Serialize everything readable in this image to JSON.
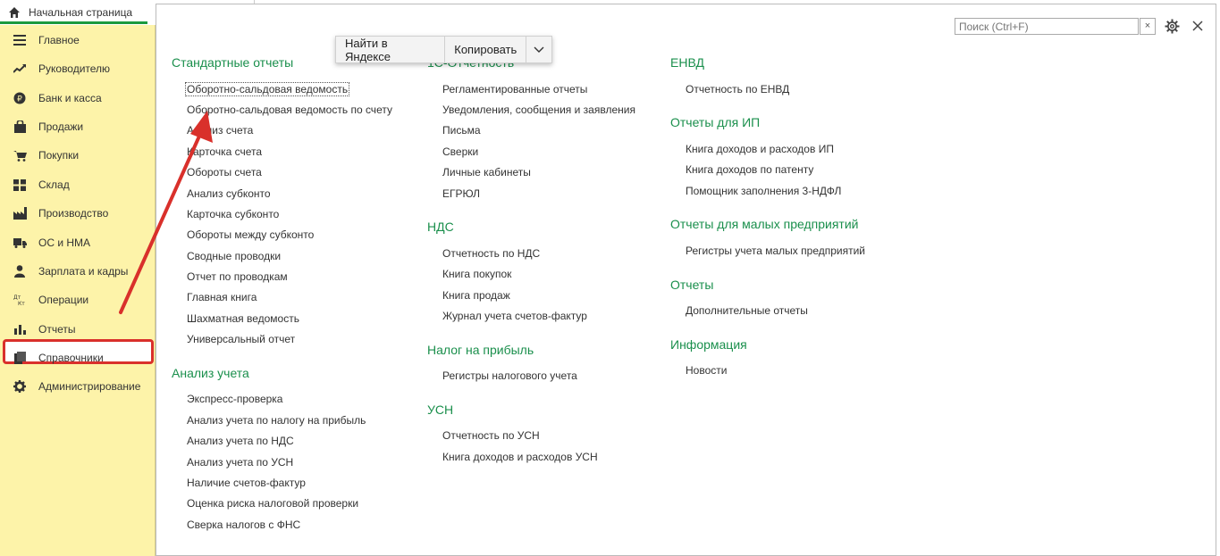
{
  "home_tab": {
    "label": "Начальная страница",
    "icon": "home-icon"
  },
  "sidebar": {
    "items": [
      {
        "label": "Главное",
        "icon": "menu-lines-icon"
      },
      {
        "label": "Руководителю",
        "icon": "trend-icon"
      },
      {
        "label": "Банк и касса",
        "icon": "ruble-coin-icon"
      },
      {
        "label": "Продажи",
        "icon": "bag-icon"
      },
      {
        "label": "Покупки",
        "icon": "cart-icon"
      },
      {
        "label": "Склад",
        "icon": "warehouse-icon"
      },
      {
        "label": "Производство",
        "icon": "factory-icon"
      },
      {
        "label": "ОС и НМА",
        "icon": "truck-icon"
      },
      {
        "label": "Зарплата и кадры",
        "icon": "person-icon"
      },
      {
        "label": "Операции",
        "icon": "dt-kt-icon",
        "icon_text": "Дт\nКт"
      },
      {
        "label": "Отчеты",
        "icon": "bar-chart-icon",
        "active": true
      },
      {
        "label": "Справочники",
        "icon": "books-icon"
      },
      {
        "label": "Администрирование",
        "icon": "gear-icon"
      }
    ]
  },
  "search": {
    "placeholder": "Поиск (Ctrl+F)",
    "clear_label": "×"
  },
  "popup": {
    "find_label": "Найти в Яндексе",
    "copy_label": "Копировать"
  },
  "col1": {
    "standard_title": "Стандартные отчеты",
    "standard_links": [
      "Оборотно-сальдовая ведомость",
      "Оборотно-сальдовая ведомость по счету",
      "Анализ счета",
      "Карточка счета",
      "Обороты счета",
      "Анализ субконто",
      "Карточка субконто",
      "Обороты между субконто",
      "Сводные проводки",
      "Отчет по проводкам",
      "Главная книга",
      "Шахматная ведомость",
      "Универсальный отчет"
    ],
    "analysis_title": "Анализ учета",
    "analysis_links": [
      "Экспресс-проверка",
      "Анализ учета по налогу на прибыль",
      "Анализ учета по НДС",
      "Анализ учета по УСН",
      "Наличие счетов-фактур",
      "Оценка риска налоговой проверки",
      "Сверка налогов с ФНС"
    ]
  },
  "col2": {
    "reporting_title": "1С-Отчетность",
    "reporting_links": [
      "Регламентированные отчеты",
      "Уведомления, сообщения и заявления",
      "Письма",
      "Сверки",
      "Личные кабинеты",
      "ЕГРЮЛ"
    ],
    "vat_title": "НДС",
    "vat_links": [
      "Отчетность по НДС",
      "Книга покупок",
      "Книга продаж",
      "Журнал учета счетов-фактур"
    ],
    "profit_title": "Налог на прибыль",
    "profit_links": [
      "Регистры налогового учета"
    ],
    "usn_title": "УСН",
    "usn_links": [
      "Отчетность по УСН",
      "Книга доходов и расходов УСН"
    ]
  },
  "col3": {
    "envd_title": "ЕНВД",
    "envd_links": [
      "Отчетность по ЕНВД"
    ],
    "ip_title": "Отчеты для ИП",
    "ip_links": [
      "Книга доходов и расходов ИП",
      "Книга доходов по патенту",
      "Помощник заполнения 3-НДФЛ"
    ],
    "small_title": "Отчеты для малых предприятий",
    "small_links": [
      "Регистры учета малых предприятий"
    ],
    "reports_title": "Отчеты",
    "reports_links": [
      "Дополнительные отчеты"
    ],
    "info_title": "Информация",
    "info_links": [
      "Новости"
    ]
  },
  "colors": {
    "accent_green": "#1a8f4c",
    "sidebar_bg": "#fdf3a9",
    "highlight_red": "#d9302b"
  }
}
